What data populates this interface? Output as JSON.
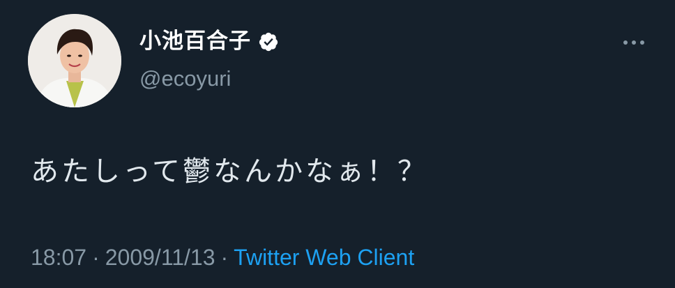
{
  "author": {
    "display_name": "小池百合子",
    "handle": "@ecoyuri",
    "verified_icon": "verified-badge-icon"
  },
  "tweet": {
    "text": "あたしって鬱なんかなぁ！？"
  },
  "meta": {
    "time": "18:07",
    "separator": "·",
    "date": "2009/11/13",
    "client": "Twitter Web Client"
  },
  "icons": {
    "more": "more-horizontal-icon"
  },
  "colors": {
    "background": "#15202b",
    "text": "#e1e8ed",
    "secondary": "#8899a6",
    "link": "#1da1f2"
  }
}
